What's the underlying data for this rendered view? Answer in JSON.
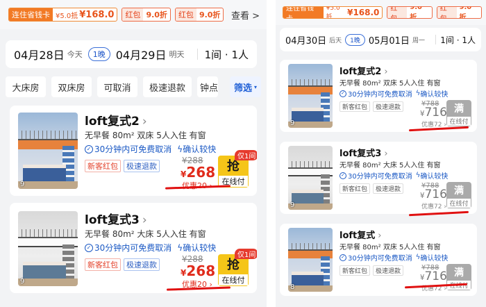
{
  "left": {
    "promo": {
      "card_label": "连住省钱卡",
      "card_small": "¥5.0抵",
      "card_value": "¥168.0",
      "red1_label": "红包",
      "red1_value": "9.0折",
      "red2_label": "红包",
      "red2_value": "9.0折",
      "look": "查看",
      "look_chevron": ">"
    },
    "dates": {
      "checkin": "04月28日",
      "checkin_sub": "今天",
      "nights": "1晚",
      "checkout": "04月29日",
      "checkout_sub": "明天",
      "guests": "1间 · 1人"
    },
    "filters": [
      "大床房",
      "双床房",
      "可取消",
      "极速退款",
      "钟点"
    ],
    "filter_select": "筛选",
    "rooms": [
      {
        "name": "loft复式2",
        "specs": "无早餐  80m²  双床  5人入住  有窗",
        "cancel": "30分钟内可免费取消",
        "confirm": "确认较快",
        "tags": [
          "新客红包",
          "极速退款"
        ],
        "photo_count": "9",
        "orig_price": "¥288",
        "price": "268",
        "discount": "优惠20",
        "book": "抢",
        "pay": "在线付",
        "badge": "仅1间"
      },
      {
        "name": "loft复式3",
        "specs": "无早餐  80m²  大床  5人入住  有窗",
        "cancel": "30分钟内可免费取消",
        "confirm": "确认较快",
        "tags": [
          "新客红包",
          "极速退款"
        ],
        "photo_count": "9",
        "orig_price": "¥288",
        "price": "268",
        "discount": "优惠20",
        "book": "抢",
        "pay": "在线付",
        "badge": "仅1间"
      }
    ]
  },
  "right": {
    "promo": {
      "card_label": "连住省钱卡",
      "card_small": "¥5.0抵",
      "card_value": "¥168.0",
      "red1_label": "红包",
      "red1_value": "9.0折",
      "red2_label": "红包",
      "red2_value": "9.0折"
    },
    "dates": {
      "checkin": "04月30日",
      "checkin_sub": "后天",
      "nights": "1晚",
      "checkout": "05月01日",
      "checkout_sub": "周一",
      "guests": "1间 · 1人"
    },
    "rooms": [
      {
        "name": "loft复式2",
        "specs": "无早餐  80m²  双床  5人入住  有窗",
        "cancel": "30分钟内可免费取消",
        "confirm": "确认较快",
        "tags": [
          "新客红包",
          "极速退款"
        ],
        "photo_count": "9",
        "orig_price": "¥788",
        "price": "716",
        "discount": "优惠72",
        "book": "满",
        "pay": "在线付"
      },
      {
        "name": "loft复式3",
        "specs": "无早餐  80m²  大床  5人入住  有窗",
        "cancel": "30分钟内可免费取消",
        "confirm": "确认较快",
        "tags": [
          "新客红包",
          "极速退款"
        ],
        "photo_count": "9",
        "orig_price": "¥788",
        "price": "716",
        "discount": "优惠72",
        "book": "满",
        "pay": "在线付"
      },
      {
        "name": "loft复式",
        "specs": "无早餐  80m²  双床  5人入住  有窗",
        "cancel": "30分钟内可免费取消",
        "confirm": "确认较快",
        "tags": [
          "新客红包",
          "极速退款"
        ],
        "photo_count": "8",
        "orig_price": "¥788",
        "price": "716",
        "discount": "优惠72",
        "book": "满",
        "pay": "在线付"
      }
    ]
  },
  "colors": {
    "accent_orange": "#f27a25",
    "price_red": "#e02b1b",
    "link_blue": "#1a58c4",
    "book_gold": "#f5c518",
    "sold_grey": "#aaaaaa"
  }
}
